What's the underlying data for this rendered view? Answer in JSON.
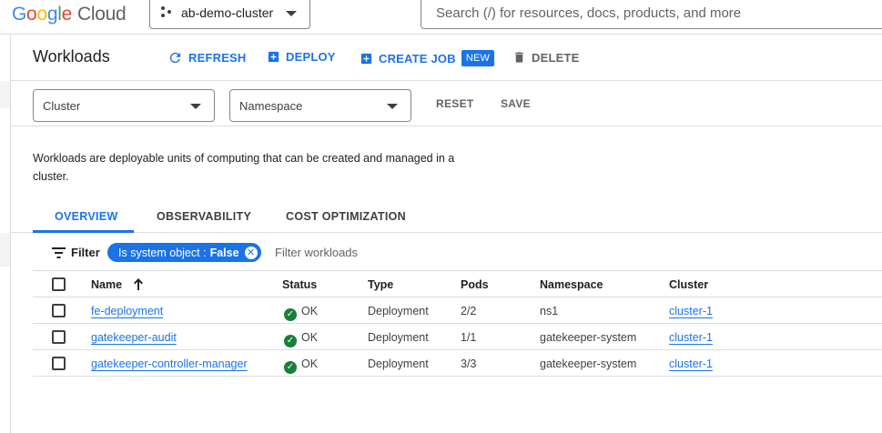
{
  "topbar": {
    "logo_google": "Google",
    "logo_cloud": "Cloud",
    "project": "ab-demo-cluster",
    "search_placeholder": "Search (/) for resources, docs, products, and more"
  },
  "toolbar": {
    "title": "Workloads",
    "refresh": "REFRESH",
    "deploy": "DEPLOY",
    "create_job": "CREATE JOB",
    "new_badge": "NEW",
    "delete": "DELETE"
  },
  "filters": {
    "cluster": "Cluster",
    "namespace": "Namespace",
    "reset": "RESET",
    "save": "SAVE"
  },
  "description": "Workloads are deployable units of computing that can be created and managed in a cluster.",
  "tabs": [
    "OVERVIEW",
    "OBSERVABILITY",
    "COST OPTIMIZATION"
  ],
  "filter_bar": {
    "label": "Filter",
    "chip_key": "Is system object :",
    "chip_value": "False",
    "placeholder": "Filter workloads"
  },
  "table": {
    "columns": [
      "Name",
      "Status",
      "Type",
      "Pods",
      "Namespace",
      "Cluster"
    ],
    "rows": [
      {
        "name": "fe-deployment",
        "status": "OK",
        "type": "Deployment",
        "pods": "2/2",
        "namespace": "ns1",
        "cluster": "cluster-1"
      },
      {
        "name": "gatekeeper-audit",
        "status": "OK",
        "type": "Deployment",
        "pods": "1/1",
        "namespace": "gatekeeper-system",
        "cluster": "cluster-1"
      },
      {
        "name": "gatekeeper-controller-manager",
        "status": "OK",
        "type": "Deployment",
        "pods": "3/3",
        "namespace": "gatekeeper-system",
        "cluster": "cluster-1"
      }
    ]
  },
  "colors": {
    "accent": "#1a73e8",
    "ok": "#188038",
    "border": "#dadce0"
  }
}
